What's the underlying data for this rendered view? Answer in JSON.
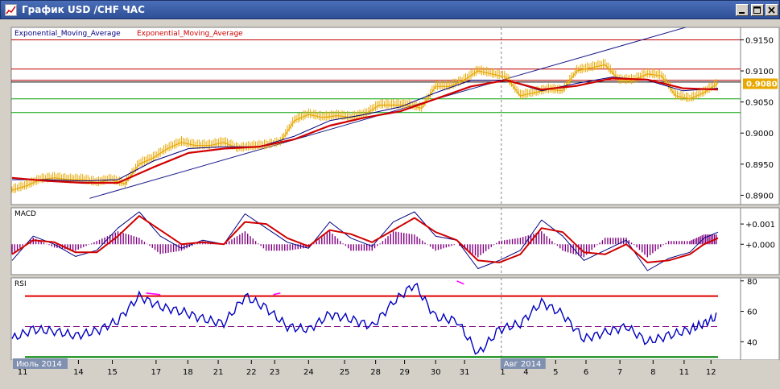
{
  "window": {
    "title": "График USD /CHF  ЧАС",
    "buttons": [
      "minimize-button",
      "maximize-button",
      "close-button"
    ]
  },
  "colors": {
    "background": "#ffffff",
    "frame": "#d4d0c8",
    "price": "#e8a800",
    "ema_fast": "#000080",
    "ema_slow": "#d00000",
    "trendline": "#1c1c8c",
    "resistance": "#c00000",
    "support": "#00a000",
    "macd_hist": "#800080",
    "rsi": "#0000c0",
    "rsi_overbought": "#ff00ff",
    "rsi_upper": "#e00000",
    "rsi_mid": "#800080",
    "rsi_lower": "#008000",
    "price_badge": "#e8a800"
  },
  "chart_data": [
    {
      "panel": "price",
      "type": "line",
      "title": "",
      "legend": [
        {
          "name": "Exponential_Moving_Average",
          "color": "#000080"
        },
        {
          "name": "Exponential_Moving_Average",
          "color": "#d00000"
        }
      ],
      "ylim": [
        0.8885,
        0.917
      ],
      "y_ticks": [
        "0.9150",
        "0.9100",
        "0.9050",
        "0.9000",
        "0.8950",
        "0.8900"
      ],
      "current_price": "0.9080",
      "x_index_range": [
        0,
        100
      ],
      "series": [
        {
          "name": "price",
          "x": [
            0,
            2,
            4,
            6,
            8,
            10,
            12,
            14,
            16,
            18,
            20,
            22,
            24,
            26,
            28,
            30,
            32,
            34,
            36,
            38,
            40,
            42,
            44,
            46,
            48,
            50,
            52,
            54,
            56,
            58,
            60,
            62,
            64,
            66,
            68,
            70,
            72,
            74,
            76,
            78,
            80,
            82,
            84,
            86,
            88,
            90,
            92,
            94,
            96,
            98,
            100
          ],
          "y": [
            0.8908,
            0.8915,
            0.8925,
            0.8928,
            0.8925,
            0.8925,
            0.892,
            0.8925,
            0.8918,
            0.895,
            0.896,
            0.8975,
            0.8985,
            0.898,
            0.898,
            0.8985,
            0.8975,
            0.8978,
            0.898,
            0.8985,
            0.902,
            0.903,
            0.9025,
            0.9028,
            0.9025,
            0.903,
            0.9045,
            0.9045,
            0.9045,
            0.904,
            0.9075,
            0.9075,
            0.9085,
            0.91,
            0.9095,
            0.909,
            0.906,
            0.9065,
            0.907,
            0.9068,
            0.91,
            0.9105,
            0.911,
            0.9085,
            0.9085,
            0.9095,
            0.9092,
            0.906,
            0.9055,
            0.9065,
            0.908
          ]
        },
        {
          "name": "ema_fast",
          "x": [
            0,
            5,
            10,
            15,
            20,
            25,
            30,
            35,
            40,
            45,
            50,
            55,
            60,
            65,
            70,
            75,
            80,
            85,
            90,
            95,
            100
          ],
          "y": [
            0.8925,
            0.8925,
            0.8923,
            0.8925,
            0.8955,
            0.8975,
            0.8978,
            0.8978,
            0.8995,
            0.902,
            0.903,
            0.9042,
            0.9065,
            0.9085,
            0.9085,
            0.9068,
            0.908,
            0.909,
            0.9085,
            0.9068,
            0.9072
          ]
        },
        {
          "name": "ema_slow",
          "x": [
            0,
            5,
            10,
            15,
            20,
            25,
            30,
            35,
            40,
            45,
            50,
            55,
            60,
            65,
            70,
            75,
            80,
            85,
            90,
            95,
            100
          ],
          "y": [
            0.8928,
            0.8923,
            0.892,
            0.892,
            0.8945,
            0.8968,
            0.8975,
            0.8978,
            0.899,
            0.9012,
            0.9025,
            0.9035,
            0.9055,
            0.9075,
            0.9085,
            0.907,
            0.9076,
            0.9088,
            0.9086,
            0.9072,
            0.907
          ]
        }
      ],
      "trendline": {
        "x": [
          11,
          100
        ],
        "y": [
          0.8895,
          0.9185
        ]
      },
      "horizontal_levels": [
        {
          "y": 0.915,
          "color": "#c00000"
        },
        {
          "y": 0.9103,
          "color": "#c00000"
        },
        {
          "y": 0.9085,
          "color": "#c00000"
        },
        {
          "y": 0.9082,
          "color": "#000000"
        },
        {
          "y": 0.9055,
          "color": "#00a000"
        },
        {
          "y": 0.9033,
          "color": "#00a000"
        }
      ]
    },
    {
      "panel": "macd",
      "type": "line",
      "title": "MACD",
      "ylim": [
        -0.0015,
        0.0018
      ],
      "y_ticks": [
        "+0.001",
        "+0.000"
      ],
      "series": [
        {
          "name": "macd",
          "x": [
            0,
            3,
            6,
            9,
            12,
            15,
            18,
            21,
            24,
            27,
            30,
            33,
            36,
            39,
            42,
            45,
            48,
            51,
            54,
            57,
            60,
            63,
            66,
            69,
            72,
            75,
            78,
            81,
            84,
            87,
            90,
            93,
            96,
            98,
            100
          ],
          "y": [
            -0.0008,
            0.0004,
            0.0,
            -0.0006,
            -0.0003,
            0.0008,
            0.0016,
            0.0004,
            -0.0002,
            0.0002,
            0.0,
            0.0015,
            0.0008,
            0.0001,
            -0.0002,
            0.0011,
            0.0003,
            -0.0001,
            0.0011,
            0.0016,
            0.0004,
            0.0002,
            -0.0012,
            -0.0008,
            -0.0003,
            0.0012,
            0.0004,
            -0.0008,
            -0.0003,
            0.0002,
            -0.0013,
            -0.0007,
            -0.0004,
            0.0003,
            0.0006
          ]
        },
        {
          "name": "signal",
          "x": [
            0,
            3,
            6,
            9,
            12,
            15,
            18,
            21,
            24,
            27,
            30,
            33,
            36,
            39,
            42,
            45,
            48,
            51,
            54,
            57,
            60,
            63,
            66,
            69,
            72,
            75,
            78,
            81,
            84,
            87,
            90,
            93,
            96,
            98,
            100
          ],
          "y": [
            -0.0005,
            0.0002,
            0.0001,
            -0.0004,
            -0.0004,
            0.0004,
            0.0014,
            0.0007,
            0.0,
            0.0001,
            0.0,
            0.0011,
            0.001,
            0.0003,
            -0.0001,
            0.0007,
            0.0005,
            0.0001,
            0.0007,
            0.0013,
            0.0006,
            0.0002,
            -0.0008,
            -0.0009,
            -0.0005,
            0.0008,
            0.0006,
            -0.0004,
            -0.0005,
            0.0,
            -0.0009,
            -0.0008,
            -0.0005,
            0.0,
            0.0003
          ]
        }
      ]
    },
    {
      "panel": "rsi",
      "type": "line",
      "title": "RSI",
      "ylim": [
        28,
        82
      ],
      "y_ticks": [
        "80",
        "60",
        "40"
      ],
      "levels": [
        70,
        50,
        30
      ],
      "series": [
        {
          "name": "rsi",
          "x": [
            0,
            3,
            6,
            9,
            12,
            15,
            18,
            21,
            24,
            27,
            30,
            33,
            36,
            39,
            42,
            45,
            48,
            51,
            54,
            57,
            60,
            63,
            66,
            69,
            72,
            75,
            78,
            81,
            84,
            87,
            90,
            93,
            96,
            98,
            100
          ],
          "y": [
            42,
            48,
            47,
            44,
            47,
            54,
            70,
            63,
            60,
            55,
            52,
            70,
            62,
            50,
            48,
            58,
            55,
            50,
            66,
            78,
            56,
            54,
            32,
            48,
            52,
            66,
            58,
            42,
            46,
            50,
            40,
            44,
            48,
            52,
            57
          ]
        }
      ],
      "overbought_points": [
        [
          19,
          72
        ],
        [
          21,
          71
        ],
        [
          37,
          71
        ],
        [
          38,
          72
        ],
        [
          63,
          80
        ],
        [
          64,
          78
        ]
      ]
    }
  ],
  "x_axis": {
    "ticks": [
      {
        "i": 1.5,
        "label": "11"
      },
      {
        "i": 9.4,
        "label": "14"
      },
      {
        "i": 14.2,
        "label": "15"
      },
      {
        "i": 20.4,
        "label": "17"
      },
      {
        "i": 24.9,
        "label": "18"
      },
      {
        "i": 29.2,
        "label": "21"
      },
      {
        "i": 33.9,
        "label": "22"
      },
      {
        "i": 37.2,
        "label": "23"
      },
      {
        "i": 42.0,
        "label": "24"
      },
      {
        "i": 47.1,
        "label": "25"
      },
      {
        "i": 51.5,
        "label": "28"
      },
      {
        "i": 55.6,
        "label": "29"
      },
      {
        "i": 60.0,
        "label": "30"
      },
      {
        "i": 64.1,
        "label": "31"
      },
      {
        "i": 69.5,
        "label": "1"
      },
      {
        "i": 72.8,
        "label": "4"
      },
      {
        "i": 77.0,
        "label": "5"
      },
      {
        "i": 81.3,
        "label": "6"
      },
      {
        "i": 86.1,
        "label": "7"
      },
      {
        "i": 90.8,
        "label": "8"
      },
      {
        "i": 95.2,
        "label": "11"
      },
      {
        "i": 99.0,
        "label": "12"
      }
    ],
    "period_labels": [
      {
        "i": 0,
        "label": "Июль 2014"
      },
      {
        "i": 69.3,
        "label": "Авг 2014"
      }
    ],
    "separator_index": 69.3
  }
}
